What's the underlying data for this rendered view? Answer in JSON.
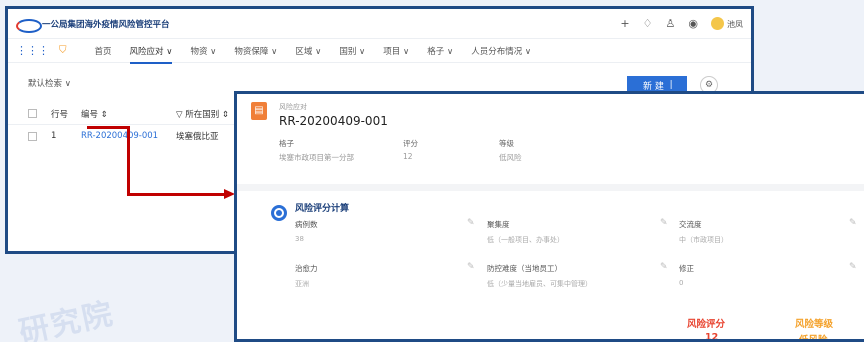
{
  "app": {
    "title": "一公局集团海外疫情风险管控平台",
    "user": "池凤"
  },
  "header_icons": [
    "plus-icon",
    "bell-icon",
    "user-icon",
    "globe-icon"
  ],
  "nav": {
    "items": [
      {
        "label": "首页",
        "dropdown": false
      },
      {
        "label": "风险应对",
        "dropdown": true,
        "active": true
      },
      {
        "label": "物资",
        "dropdown": true
      },
      {
        "label": "物资保障",
        "dropdown": true
      },
      {
        "label": "区域",
        "dropdown": true
      },
      {
        "label": "国别",
        "dropdown": true
      },
      {
        "label": "项目",
        "dropdown": true
      },
      {
        "label": "格子",
        "dropdown": true
      },
      {
        "label": "人员分布情况",
        "dropdown": true
      }
    ]
  },
  "list": {
    "filter_label": "默认检索",
    "new_button": "新 建",
    "columns": [
      "行号",
      "编号",
      "所在国别"
    ],
    "rows": [
      {
        "no": "1",
        "code": "RR-20200409-001",
        "country": "埃塞俄比亚"
      }
    ]
  },
  "detail": {
    "record_label": "风险应对",
    "record_id": "RR-20200409-001",
    "meta": [
      {
        "label": "格子",
        "value": "埃塞市政项目第一分部"
      },
      {
        "label": "评分",
        "value": "12"
      },
      {
        "label": "等级",
        "value": "低风险"
      }
    ],
    "section_title": "风险评分计算",
    "fields": [
      {
        "label": "病例数",
        "value": "38"
      },
      {
        "label": "聚集度",
        "value": "低（一般项目、办事处）"
      },
      {
        "label": "交流度",
        "value": "中（市政项目）"
      },
      {
        "label": "治愈力",
        "value": "亚洲"
      },
      {
        "label": "防控难度（当地员工）",
        "value": "低（少量当地雇员、可集中管理）"
      },
      {
        "label": "修正",
        "value": "0"
      }
    ],
    "score": {
      "label": "风险评分",
      "value": "12",
      "color": "#e8432f"
    },
    "level": {
      "label": "风险等级",
      "value": "低风险",
      "color": "#f4a12a"
    }
  },
  "watermark": "研究院"
}
